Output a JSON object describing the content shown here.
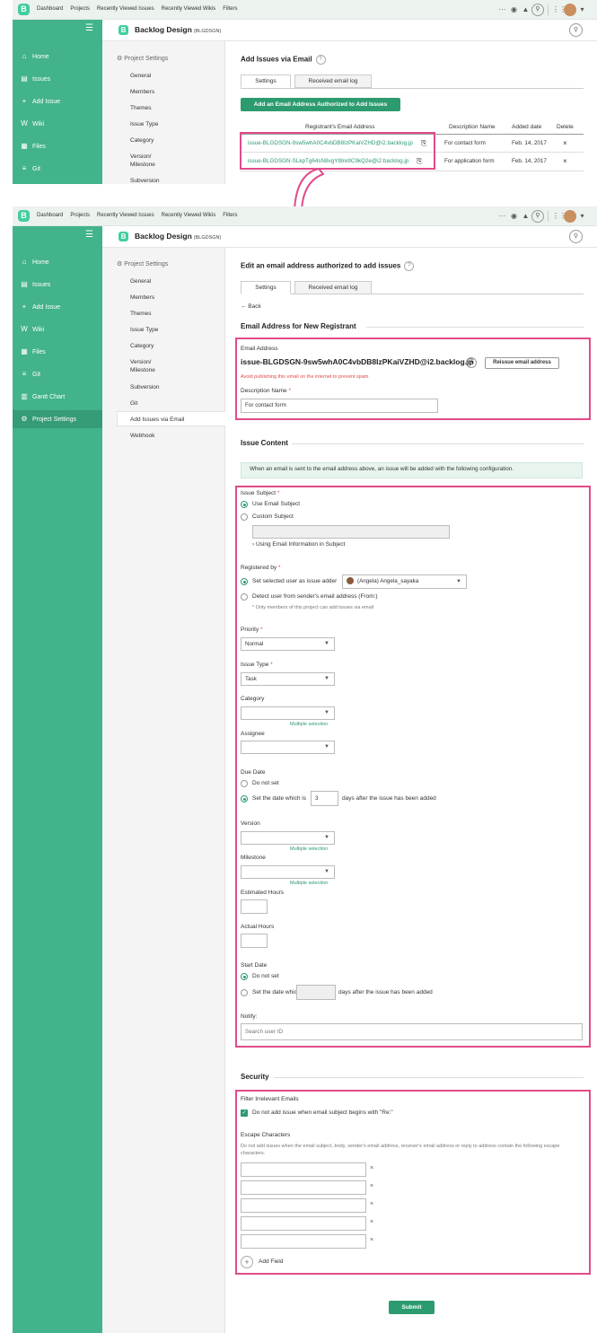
{
  "topnav": {
    "logo": "B",
    "items": [
      "Dashboard",
      "Projects",
      "Recently Viewed Issues",
      "Recently Viewed Wikis",
      "Filters"
    ],
    "more": "···"
  },
  "sidebar_top": {
    "items": [
      {
        "icon": "home-icon",
        "label": "Home"
      },
      {
        "icon": "issues-icon",
        "label": "Issues"
      },
      {
        "icon": "add-issue-icon",
        "label": "Add Issue"
      },
      {
        "icon": "wiki-icon",
        "label": "Wiki"
      },
      {
        "icon": "files-icon",
        "label": "Files"
      },
      {
        "icon": "git-icon",
        "label": "Git"
      }
    ]
  },
  "sidebar_bottom": {
    "items": [
      {
        "icon": "home-icon",
        "label": "Home"
      },
      {
        "icon": "issues-icon",
        "label": "Issues"
      },
      {
        "icon": "add-issue-icon",
        "label": "Add Issue"
      },
      {
        "icon": "wiki-icon",
        "label": "Wiki"
      },
      {
        "icon": "files-icon",
        "label": "Files"
      },
      {
        "icon": "git-icon",
        "label": "Git"
      },
      {
        "icon": "gantt-chart-icon",
        "label": "Gantt Chart"
      },
      {
        "icon": "project-settings-icon",
        "label": "Project Settings"
      }
    ],
    "active": "Project Settings"
  },
  "project": {
    "name": "Backlog Design",
    "key": "(BLGDSGN)",
    "logo": "B"
  },
  "settings_nav": {
    "title": "Project Settings",
    "items_top": [
      "General",
      "Members",
      "Themes",
      "Issue Type",
      "Category",
      "Version/\nMilestone",
      "Subversion"
    ],
    "items_bottom": [
      "General",
      "Members",
      "Themes",
      "Issue Type",
      "Category",
      "Version/\nMilestone",
      "Subversion",
      "Git",
      "Add Issues via Email",
      "Webhook"
    ],
    "active": "Add Issues via Email"
  },
  "top_panel": {
    "title": "Add Issues via Email",
    "tabs": [
      "Settings",
      "Received email log"
    ],
    "add_button": "Add an Email Address Authorized to Add Issues",
    "columns": [
      "Registrant's Email Address",
      "Description Name",
      "Added date",
      "Delete"
    ],
    "rows": [
      {
        "email": "issue-BLGDSGN-9sw5whA0C4vbDB8IzPKaiVZHD@i2.backlog.jp",
        "description": "For contact form",
        "date": "Feb. 14, 2017"
      },
      {
        "email": "issue-BLGDSGN-SLkpTg64sN8vgYt8re9C9kQ2e@i2.backlog.jp",
        "description": "For application form",
        "date": "Feb. 14, 2017"
      }
    ]
  },
  "edit": {
    "title": "Edit an email address authorized to add issues",
    "tabs": [
      "Settings",
      "Received email log"
    ],
    "back": "← Back",
    "section_email": "Email Address for New Registrant",
    "email_label": "Email Address",
    "email_value": "issue-BLGDSGN-9sw5whA0C4vbDB8IzPKaiVZHD@i2.backlog.jp",
    "reissue_button": "Reissue email address",
    "warning": "Avoid publishing this email on the internet to prevent spam.",
    "desc_label": "Description Name",
    "desc_value": "For contact form",
    "section_content": "Issue Content",
    "info": "When an email is sent to the email address above, an issue will be added with the following configuration.",
    "subject_label": "Issue Subject",
    "subject_opt1": "Use Email Subject",
    "subject_opt2": "Custom Subject",
    "subject_info": "Using Email Information in Subject",
    "registered_label": "Registered by",
    "reg_opt1": "Set selected user as issue adder",
    "reg_user": "(Angela) Angela_sayaka",
    "reg_opt2": "Detect user from sender's email address (From:)",
    "reg_note": "* Only members of this project can add issues via email",
    "priority_label": "Priority",
    "priority_value": "Normal",
    "type_label": "Issue Type",
    "type_value": "Task",
    "category_label": "Category",
    "multiple": "Multiple selection",
    "assignee_label": "Assignee",
    "due_label": "Due Date",
    "due_opt1": "Do not set",
    "due_opt2_a": "Set the date which is",
    "due_days": "3",
    "due_opt2_b": "days after the issue has been added",
    "version_label": "Version",
    "milestone_label": "Milestone",
    "est_label": "Estimated Hours",
    "actual_label": "Actual Hours",
    "start_label": "Start Date",
    "start_opt1": "Do not set",
    "start_opt2_a": "Set the date which is",
    "start_opt2_b": "days after the issue has been added",
    "notify_label": "Notify:",
    "notify_placeholder": "Search user ID",
    "section_security": "Security",
    "filter_label": "Filter Irrelevant Emails",
    "filter_opt": "Do not add issue when email subject begins with \"Re:\"",
    "escape_label": "Escape Characters",
    "escape_desc": "Do not add issues when the email subject, body, sender's email address, receiver's email address or reply to address contain the following escape characters.",
    "add_field": "Add Field",
    "submit": "Submit"
  },
  "colors": {
    "accent": "#42b38a",
    "button": "#2d9b70",
    "highlight": "#e14b8a"
  }
}
